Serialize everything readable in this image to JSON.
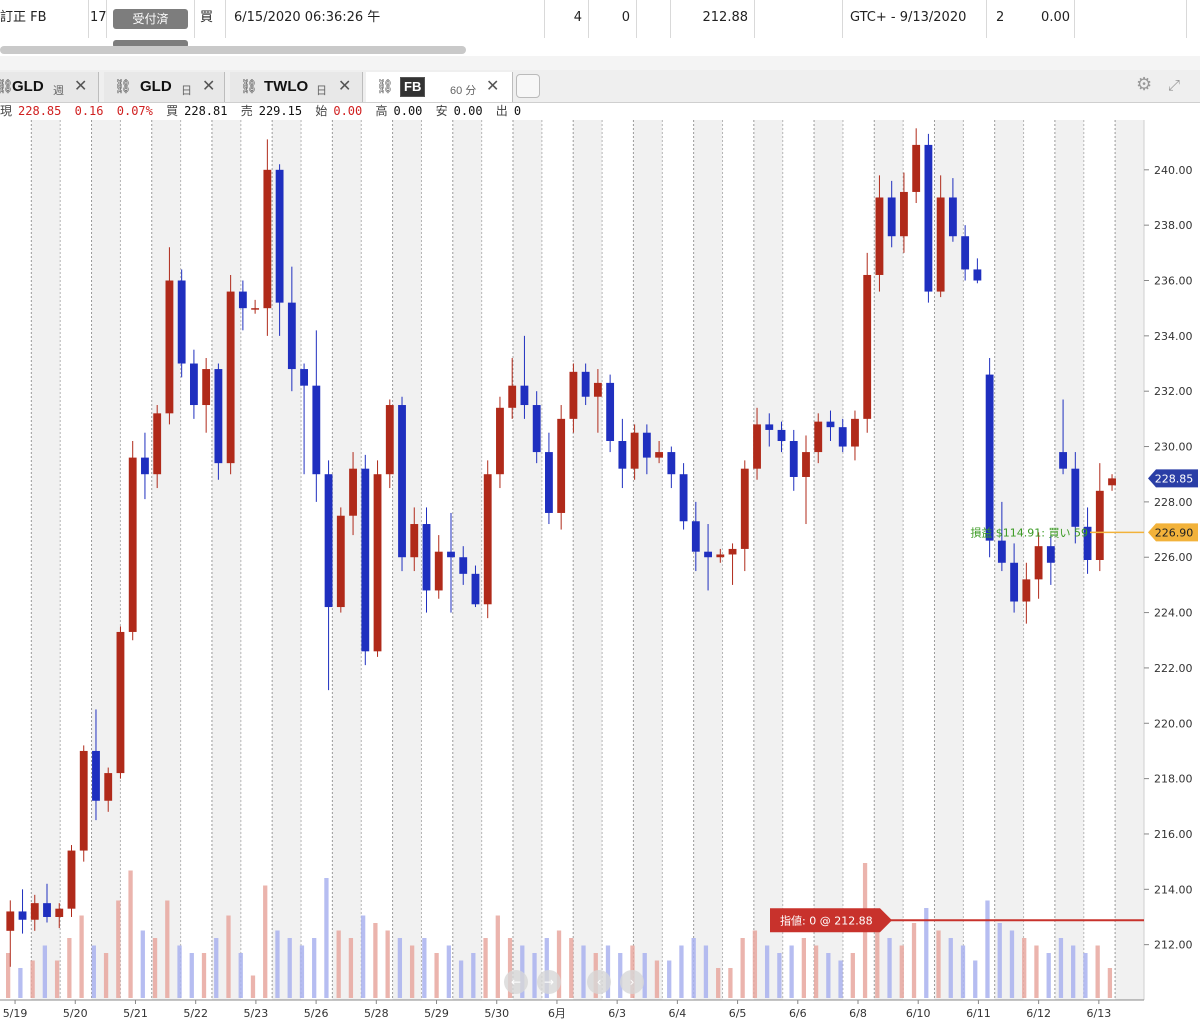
{
  "order_row": {
    "symbol": "訂正 FB",
    "qty_partial": "17",
    "status_button": "受付済",
    "side": "買",
    "time": "6/15/2020 06:36:26 午",
    "col_a": "4",
    "col_b": "0",
    "price": "212.88",
    "tif": "GTC+ - 9/13/2020",
    "col_c": "2",
    "col_d": "0.00"
  },
  "tabs": [
    {
      "symbol": "GLD",
      "period": "週"
    },
    {
      "symbol": "GLD",
      "period": "日"
    },
    {
      "symbol": "TWLO",
      "period": "日"
    },
    {
      "symbol": "FB",
      "period": "60 分"
    }
  ],
  "quote": {
    "last_label": "現",
    "last": "228.85",
    "change": "0.16",
    "change_pct": "0.07%",
    "bid_label": "買",
    "bid": "228.81",
    "ask_label": "売",
    "ask": "229.15",
    "open_label": "始",
    "open": "0.00",
    "high_label": "高",
    "high": "0.00",
    "low_label": "安",
    "low": "0.00",
    "vol_label": "出",
    "vol": "0"
  },
  "colors": {
    "up": "#b02a1a",
    "down": "#1f2fbf",
    "last_badge": "#2a3ea6",
    "position_line": "#f2b23a",
    "order_line": "#c8322c",
    "pnl_text": "#3a9a22"
  },
  "chart_data": {
    "type": "candlestick",
    "symbol": "FB",
    "interval": "60 分",
    "ylim": [
      210,
      241.8
    ],
    "yticks": [
      212,
      214,
      216,
      218,
      220,
      222,
      224,
      226,
      228,
      230,
      232,
      234,
      236,
      238,
      240
    ],
    "x_labels": [
      "5/19",
      "5/20",
      "5/21",
      "5/22",
      "5/23",
      "5/26",
      "5/28",
      "5/29",
      "5/30",
      "6月",
      "6/3",
      "6/4",
      "6/5",
      "6/6",
      "6/8",
      "6/10",
      "6/11",
      "6/12",
      "6/13"
    ],
    "grid": true,
    "last_price": "228.85",
    "position": {
      "price": "226.90",
      "label": "損益 $114.91: 買い 59"
    },
    "order": {
      "price": 212.88,
      "label": "指値: 0 @ 212.88"
    },
    "candles": [
      {
        "o": 212.5,
        "h": 213.6,
        "l": 211.2,
        "c": 213.2
      },
      {
        "o": 213.2,
        "h": 214.0,
        "l": 212.4,
        "c": 212.9
      },
      {
        "o": 212.9,
        "h": 213.8,
        "l": 212.5,
        "c": 213.5
      },
      {
        "o": 213.5,
        "h": 214.2,
        "l": 212.8,
        "c": 213.0
      },
      {
        "o": 213.0,
        "h": 213.5,
        "l": 212.6,
        "c": 213.3
      },
      {
        "o": 213.3,
        "h": 215.6,
        "l": 213.0,
        "c": 215.4
      },
      {
        "o": 215.4,
        "h": 219.2,
        "l": 215.0,
        "c": 219.0
      },
      {
        "o": 219.0,
        "h": 220.5,
        "l": 216.5,
        "c": 217.2
      },
      {
        "o": 217.2,
        "h": 218.4,
        "l": 216.8,
        "c": 218.2
      },
      {
        "o": 218.2,
        "h": 223.5,
        "l": 218.0,
        "c": 223.3
      },
      {
        "o": 223.3,
        "h": 230.2,
        "l": 223.0,
        "c": 229.6
      },
      {
        "o": 229.6,
        "h": 230.5,
        "l": 228.1,
        "c": 229.0
      },
      {
        "o": 229.0,
        "h": 231.5,
        "l": 228.5,
        "c": 231.2
      },
      {
        "o": 231.2,
        "h": 237.2,
        "l": 230.8,
        "c": 236.0
      },
      {
        "o": 236.0,
        "h": 236.4,
        "l": 232.5,
        "c": 233.0
      },
      {
        "o": 233.0,
        "h": 233.5,
        "l": 231.0,
        "c": 231.5
      },
      {
        "o": 231.5,
        "h": 233.2,
        "l": 230.5,
        "c": 232.8
      },
      {
        "o": 232.8,
        "h": 233.0,
        "l": 228.8,
        "c": 229.4
      },
      {
        "o": 229.4,
        "h": 236.2,
        "l": 229.0,
        "c": 235.6
      },
      {
        "o": 235.6,
        "h": 236.0,
        "l": 234.2,
        "c": 235.0
      },
      {
        "o": 235.0,
        "h": 235.3,
        "l": 234.8,
        "c": 235.0
      },
      {
        "o": 235.0,
        "h": 241.1,
        "l": 234.0,
        "c": 240.0
      },
      {
        "o": 240.0,
        "h": 240.2,
        "l": 234.0,
        "c": 235.2
      },
      {
        "o": 235.2,
        "h": 236.5,
        "l": 232.0,
        "c": 232.8
      },
      {
        "o": 232.8,
        "h": 233.0,
        "l": 229.0,
        "c": 232.2
      },
      {
        "o": 232.2,
        "h": 234.2,
        "l": 228.0,
        "c": 229.0
      },
      {
        "o": 229.0,
        "h": 229.5,
        "l": 221.2,
        "c": 224.2
      },
      {
        "o": 224.2,
        "h": 227.8,
        "l": 224.0,
        "c": 227.5
      },
      {
        "o": 227.5,
        "h": 229.8,
        "l": 226.8,
        "c": 229.2
      },
      {
        "o": 229.2,
        "h": 229.7,
        "l": 222.1,
        "c": 222.6
      },
      {
        "o": 222.6,
        "h": 229.5,
        "l": 222.4,
        "c": 229.0
      },
      {
        "o": 229.0,
        "h": 231.7,
        "l": 228.5,
        "c": 231.5
      },
      {
        "o": 231.5,
        "h": 231.8,
        "l": 225.5,
        "c": 226.0
      },
      {
        "o": 226.0,
        "h": 227.8,
        "l": 225.5,
        "c": 227.2
      },
      {
        "o": 227.2,
        "h": 227.8,
        "l": 224.0,
        "c": 224.8
      },
      {
        "o": 224.8,
        "h": 226.8,
        "l": 224.5,
        "c": 226.2
      },
      {
        "o": 226.2,
        "h": 227.6,
        "l": 224.0,
        "c": 226.0
      },
      {
        "o": 226.0,
        "h": 226.4,
        "l": 225.0,
        "c": 225.4
      },
      {
        "o": 225.4,
        "h": 225.7,
        "l": 224.2,
        "c": 224.3
      },
      {
        "o": 224.3,
        "h": 229.5,
        "l": 223.8,
        "c": 229.0
      },
      {
        "o": 229.0,
        "h": 231.8,
        "l": 228.5,
        "c": 231.4
      },
      {
        "o": 231.4,
        "h": 233.2,
        "l": 231.0,
        "c": 232.2
      },
      {
        "o": 232.2,
        "h": 234.0,
        "l": 231.0,
        "c": 231.5
      },
      {
        "o": 231.5,
        "h": 232.0,
        "l": 229.4,
        "c": 229.8
      },
      {
        "o": 229.8,
        "h": 230.5,
        "l": 227.2,
        "c": 227.6
      },
      {
        "o": 227.6,
        "h": 231.5,
        "l": 227.0,
        "c": 231.0
      },
      {
        "o": 231.0,
        "h": 233.0,
        "l": 230.5,
        "c": 232.7
      },
      {
        "o": 232.7,
        "h": 233.0,
        "l": 231.5,
        "c": 231.8
      },
      {
        "o": 231.8,
        "h": 232.8,
        "l": 230.5,
        "c": 232.3
      },
      {
        "o": 232.3,
        "h": 232.6,
        "l": 229.8,
        "c": 230.2
      },
      {
        "o": 230.2,
        "h": 231.0,
        "l": 228.5,
        "c": 229.2
      },
      {
        "o": 229.2,
        "h": 230.8,
        "l": 228.8,
        "c": 230.5
      },
      {
        "o": 230.5,
        "h": 230.8,
        "l": 229.0,
        "c": 229.6
      },
      {
        "o": 229.6,
        "h": 230.2,
        "l": 229.4,
        "c": 229.8
      },
      {
        "o": 229.8,
        "h": 230.0,
        "l": 228.5,
        "c": 229.0
      },
      {
        "o": 229.0,
        "h": 229.4,
        "l": 227.0,
        "c": 227.3
      },
      {
        "o": 227.3,
        "h": 228.0,
        "l": 225.5,
        "c": 226.2
      },
      {
        "o": 226.2,
        "h": 227.2,
        "l": 224.8,
        "c": 226.0
      },
      {
        "o": 226.0,
        "h": 226.3,
        "l": 225.8,
        "c": 226.1
      },
      {
        "o": 226.1,
        "h": 226.5,
        "l": 225.0,
        "c": 226.3
      },
      {
        "o": 226.3,
        "h": 229.5,
        "l": 225.5,
        "c": 229.2
      },
      {
        "o": 229.2,
        "h": 231.4,
        "l": 228.8,
        "c": 230.8
      },
      {
        "o": 230.8,
        "h": 231.2,
        "l": 230.0,
        "c": 230.6
      },
      {
        "o": 230.6,
        "h": 230.9,
        "l": 229.8,
        "c": 230.2
      },
      {
        "o": 230.2,
        "h": 230.6,
        "l": 228.4,
        "c": 228.9
      },
      {
        "o": 228.9,
        "h": 230.4,
        "l": 227.2,
        "c": 229.8
      },
      {
        "o": 229.8,
        "h": 231.2,
        "l": 229.4,
        "c": 230.9
      },
      {
        "o": 230.9,
        "h": 231.3,
        "l": 230.2,
        "c": 230.7
      },
      {
        "o": 230.7,
        "h": 231.0,
        "l": 229.8,
        "c": 230.0
      },
      {
        "o": 230.0,
        "h": 231.3,
        "l": 229.5,
        "c": 231.0
      },
      {
        "o": 231.0,
        "h": 237.0,
        "l": 230.5,
        "c": 236.2
      },
      {
        "o": 236.2,
        "h": 239.8,
        "l": 235.6,
        "c": 239.0
      },
      {
        "o": 239.0,
        "h": 239.6,
        "l": 237.2,
        "c": 237.6
      },
      {
        "o": 237.6,
        "h": 239.9,
        "l": 237.0,
        "c": 239.2
      },
      {
        "o": 239.2,
        "h": 241.5,
        "l": 238.8,
        "c": 240.9
      },
      {
        "o": 240.9,
        "h": 241.3,
        "l": 235.2,
        "c": 235.6
      },
      {
        "o": 235.6,
        "h": 239.8,
        "l": 235.4,
        "c": 239.0
      },
      {
        "o": 239.0,
        "h": 239.7,
        "l": 237.4,
        "c": 237.6
      },
      {
        "o": 237.6,
        "h": 238.0,
        "l": 236.0,
        "c": 236.4
      },
      {
        "o": 236.4,
        "h": 236.8,
        "l": 235.9,
        "c": 236.0
      },
      {
        "o": 232.6,
        "h": 233.2,
        "l": 226.0,
        "c": 226.6
      },
      {
        "o": 226.6,
        "h": 228.0,
        "l": 225.5,
        "c": 225.8
      },
      {
        "o": 225.8,
        "h": 226.5,
        "l": 224.0,
        "c": 224.4
      },
      {
        "o": 224.4,
        "h": 225.8,
        "l": 223.6,
        "c": 225.2
      },
      {
        "o": 225.2,
        "h": 226.9,
        "l": 224.5,
        "c": 226.4
      },
      {
        "o": 226.4,
        "h": 226.8,
        "l": 225.0,
        "c": 225.8
      },
      {
        "o": 229.8,
        "h": 231.7,
        "l": 229.0,
        "c": 229.2
      },
      {
        "o": 229.2,
        "h": 229.8,
        "l": 226.5,
        "c": 227.1
      },
      {
        "o": 227.1,
        "h": 227.8,
        "l": 225.4,
        "c": 225.9
      },
      {
        "o": 225.9,
        "h": 229.4,
        "l": 225.5,
        "c": 228.4
      },
      {
        "o": 228.6,
        "h": 229.0,
        "l": 228.4,
        "c": 228.85
      }
    ],
    "volumes": [
      0.3,
      0.2,
      0.25,
      0.35,
      0.25,
      0.4,
      0.55,
      0.35,
      0.3,
      0.65,
      0.85,
      0.45,
      0.4,
      0.65,
      0.35,
      0.3,
      0.3,
      0.4,
      0.55,
      0.3,
      0.15,
      0.75,
      0.45,
      0.4,
      0.35,
      0.4,
      0.8,
      0.45,
      0.4,
      0.55,
      0.5,
      0.45,
      0.4,
      0.35,
      0.4,
      0.3,
      0.35,
      0.25,
      0.3,
      0.4,
      0.55,
      0.4,
      0.35,
      0.3,
      0.4,
      0.45,
      0.4,
      0.35,
      0.3,
      0.35,
      0.3,
      0.35,
      0.3,
      0.25,
      0.25,
      0.35,
      0.4,
      0.35,
      0.2,
      0.2,
      0.4,
      0.45,
      0.35,
      0.3,
      0.35,
      0.4,
      0.35,
      0.3,
      0.25,
      0.3,
      0.9,
      0.55,
      0.4,
      0.35,
      0.5,
      0.6,
      0.45,
      0.4,
      0.35,
      0.25,
      0.65,
      0.5,
      0.45,
      0.4,
      0.35,
      0.3,
      0.4,
      0.35,
      0.3,
      0.35,
      0.2
    ]
  }
}
